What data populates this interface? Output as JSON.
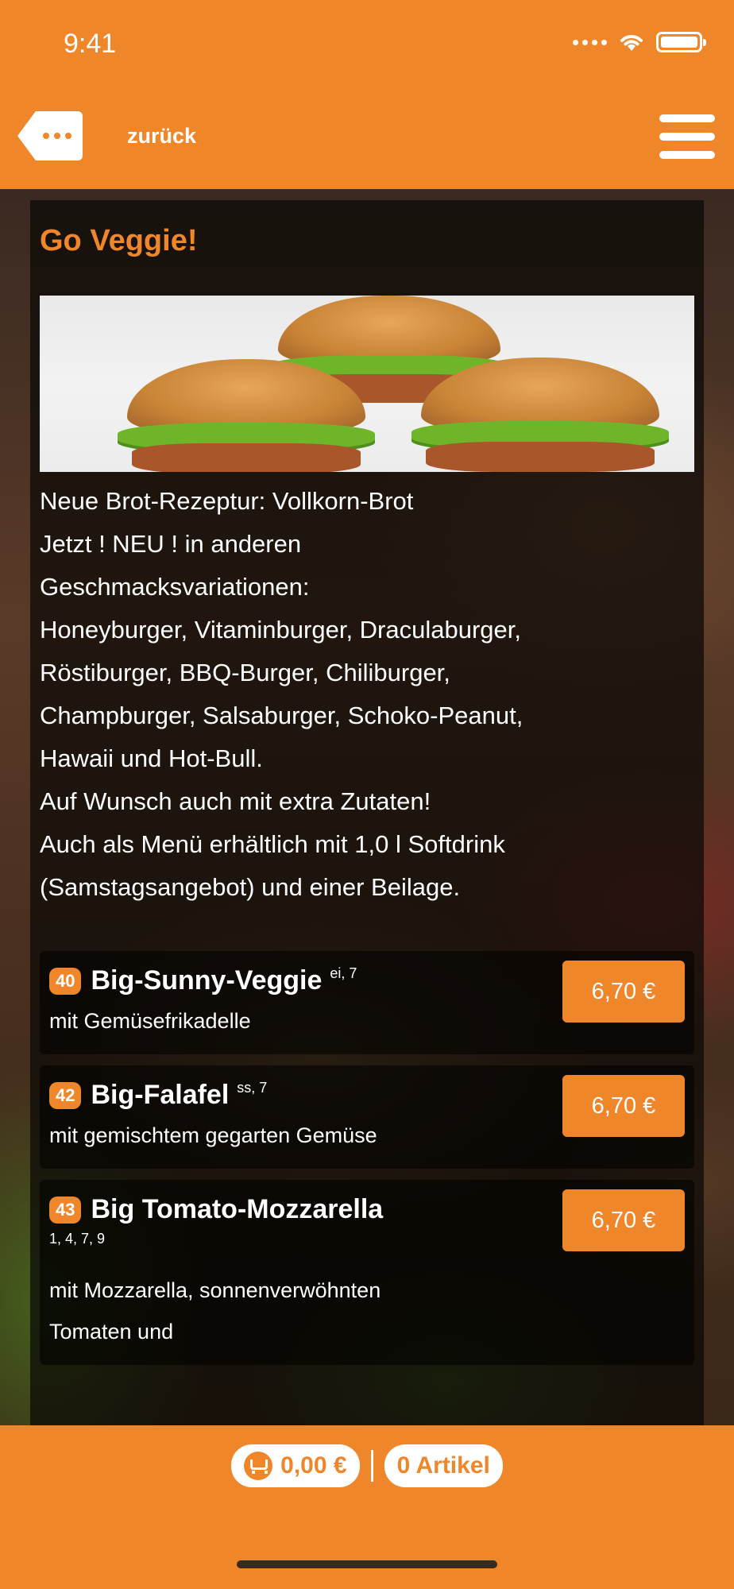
{
  "status_bar": {
    "time": "9:41"
  },
  "header": {
    "back_label": "zurück"
  },
  "section": {
    "title": "Go Veggie!",
    "description": "Neue Brot-Rezeptur: Vollkorn-Brot\nJetzt ! NEU ! in anderen\nGeschmacksvariationen:\nHoneyburger, Vitaminburger, Draculaburger,\nRöstiburger, BBQ-Burger, Chiliburger,\nChampburger, Salsaburger, Schoko-Peanut,\nHawaii und Hot-Bull.\nAuf Wunsch auch mit extra Zutaten!\nAuch als Menü erhältlich mit 1,0 l Softdrink\n(Samstagsangebot) und einer Beilage."
  },
  "items": [
    {
      "number": "40",
      "name": "Big-Sunny-Veggie",
      "allergens": "ei, 7",
      "description": "mit Gemüsefrikadelle",
      "price": "6,70 €"
    },
    {
      "number": "42",
      "name": "Big-Falafel",
      "allergens": "ss, 7",
      "description": "mit gemischtem gegarten Gemüse",
      "price": "6,70 €"
    },
    {
      "number": "43",
      "name": "Big Tomato-Mozzarella",
      "allergens": "1, 4, 7, 9",
      "description": "mit Mozzarella, sonnenverwöhnten Tomaten und",
      "price": "6,70 €"
    }
  ],
  "footer": {
    "cart_total": "0,00 €",
    "cart_count": "0 Artikel"
  },
  "colors": {
    "accent": "#f0862a"
  }
}
